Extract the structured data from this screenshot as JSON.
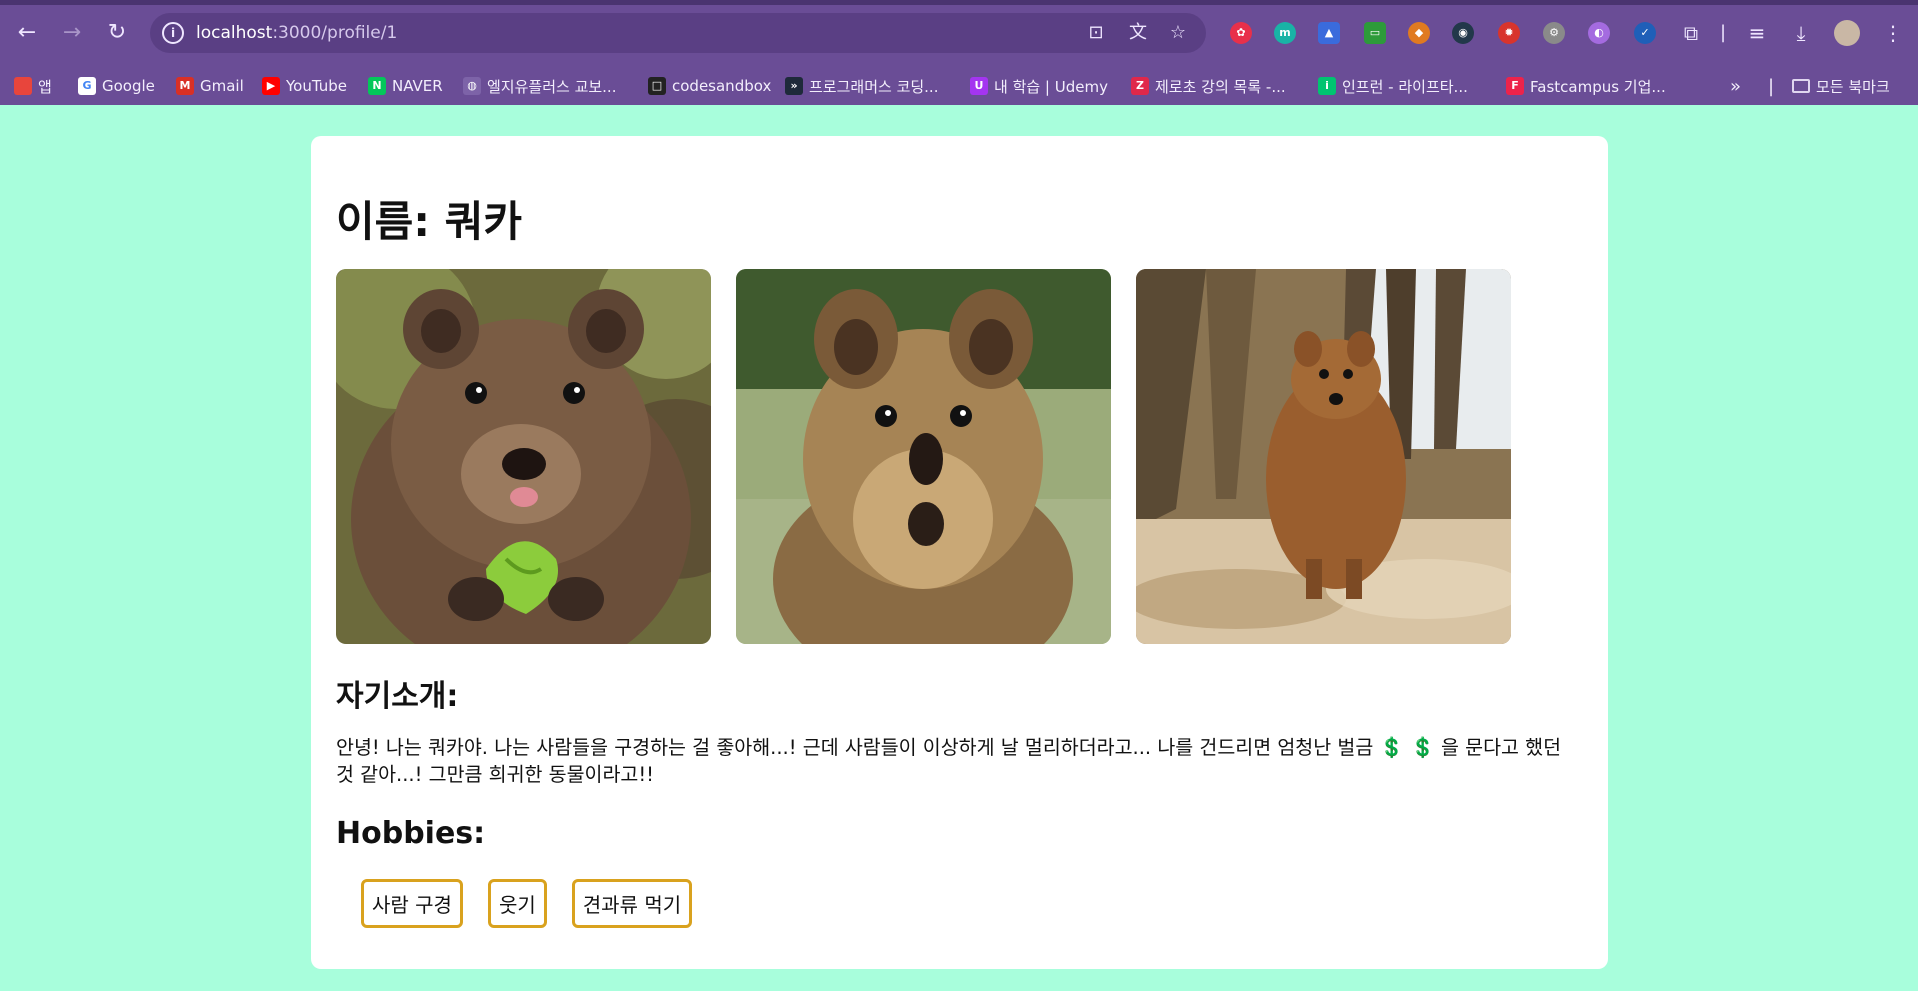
{
  "browser": {
    "url_host": "localhost",
    "url_path": ":3000/profile/1",
    "back_glyph": "←",
    "forward_glyph": "→",
    "reload_glyph": "↻",
    "bookmarks": [
      {
        "label": "앱",
        "icon": "apps-grid-icon",
        "color": "#e8453c",
        "glyph": ""
      },
      {
        "label": "Google",
        "icon": "google-icon",
        "color": "#ffffff",
        "glyph": "G"
      },
      {
        "label": "Gmail",
        "icon": "gmail-icon",
        "color": "#d93025",
        "glyph": "M"
      },
      {
        "label": "YouTube",
        "icon": "youtube-icon",
        "color": "#ff0000",
        "glyph": "▶"
      },
      {
        "label": "NAVER",
        "icon": "naver-icon",
        "color": "#03c75a",
        "glyph": "N"
      },
      {
        "label": "엘지유플러스 교보...",
        "icon": "globe-icon",
        "color": "#7d63a8",
        "glyph": "◍"
      },
      {
        "label": "codesandbox",
        "icon": "codesandbox-icon",
        "color": "#222222",
        "glyph": "□"
      },
      {
        "label": "프로그래머스 코딩...",
        "icon": "programmers-icon",
        "color": "#1e2a3a",
        "glyph": "»"
      },
      {
        "label": "내 학습 | Udemy",
        "icon": "udemy-icon",
        "color": "#a435f0",
        "glyph": "U"
      },
      {
        "label": "제로초 강의 목록 -...",
        "icon": "zerocho-icon",
        "color": "#e0284a",
        "glyph": "Z"
      },
      {
        "label": "인프런 - 라이프타...",
        "icon": "inflearn-icon",
        "color": "#00c471",
        "glyph": "i"
      },
      {
        "label": "Fastcampus 기업...",
        "icon": "fastcampus-icon",
        "color": "#ed234b",
        "glyph": "F"
      }
    ],
    "all_bookmarks_label": "모든 북마크",
    "accent": "#6a4d96"
  },
  "profile": {
    "title": "이름: 쿼카",
    "photos": [
      {
        "name": "quokka-photo-holding-leaf",
        "alt": ""
      },
      {
        "name": "quokka-photo-closeup",
        "alt": ""
      },
      {
        "name": "quokka-photo-standing",
        "alt": ""
      }
    ],
    "intro_heading": "자기소개:",
    "intro_text_a": "안녕! 나는 쿼카야. 나는 사람들을 구경하는 걸 좋아해...! 근데 사람들이 이상하게 날 멀리하더라고... 나를 건드리면 엄청난 벌금 ",
    "intro_money": "💲 💲",
    "intro_text_b": " 을 문다고 했던 것 같아...! 그만큼 희귀한 동물이라고!!",
    "hobbies_heading": "Hobbies:",
    "hobbies": [
      "사람 구경",
      "웃기",
      "견과류 먹기"
    ],
    "chip_border_color": "#d9a21e",
    "background_color": "#a8fedc"
  }
}
